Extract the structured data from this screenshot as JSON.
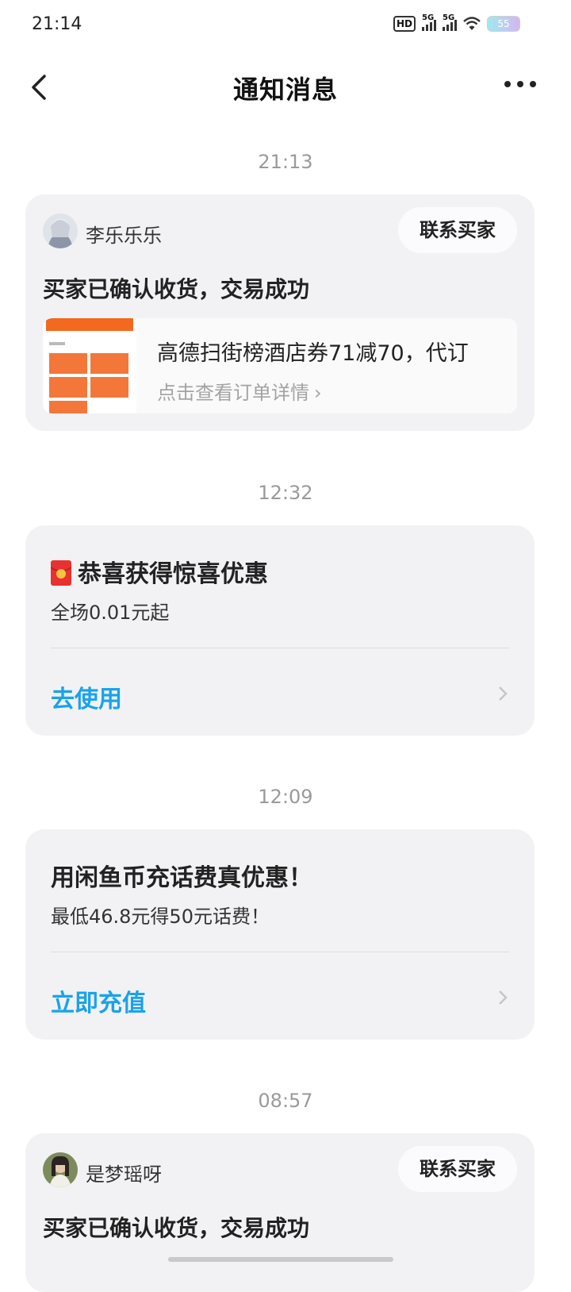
{
  "status_bar": {
    "time": "21:14",
    "hd_label": "HD",
    "network_1": "5G",
    "network_2": "5G",
    "battery": "55"
  },
  "nav": {
    "title": "通知消息"
  },
  "messages": [
    {
      "time": "21:13",
      "sender": "李乐乐乐",
      "contact_label": "联系买家",
      "title": "买家已确认收货，交易成功",
      "order_title": "高德扫街榜酒店券71减70，代订",
      "order_link": "点击查看订单详情",
      "order_link_arrow": "›"
    },
    {
      "time": "12:32",
      "title": "恭喜获得惊喜优惠",
      "subtitle": "全场0.01元起",
      "action": "去使用"
    },
    {
      "time": "12:09",
      "title": "用闲鱼币充话费真优惠！",
      "subtitle": "最低46.8元得50元话费！",
      "action": "立即充值"
    },
    {
      "time": "08:57",
      "sender": "是梦瑶呀",
      "contact_label": "联系买家",
      "title": "买家已确认收货，交易成功"
    }
  ],
  "colors": {
    "accent": "#1aa3ea",
    "card_bg": "#f2f2f4",
    "time_gray": "#9a9a9a"
  }
}
